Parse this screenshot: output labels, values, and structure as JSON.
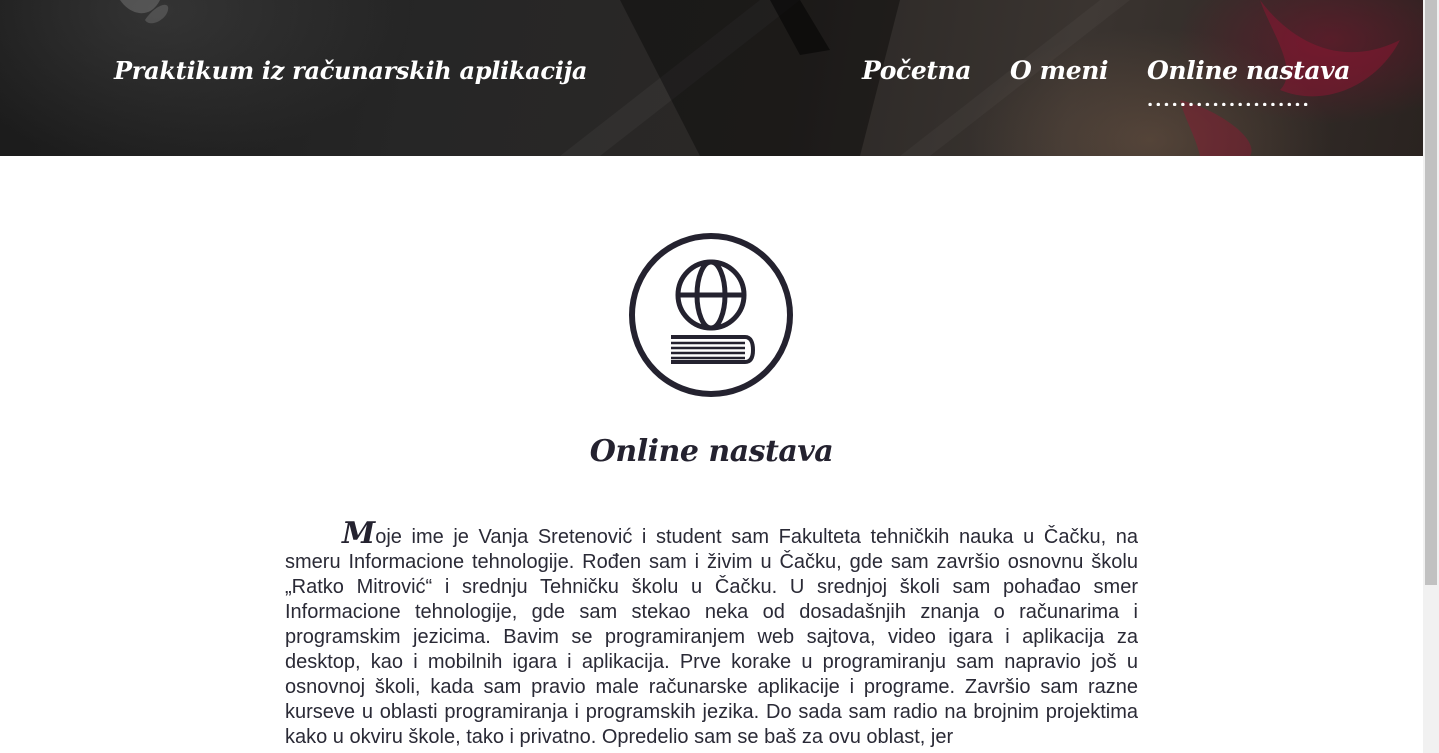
{
  "header": {
    "site_title": "Praktikum iz računarskih aplikacija",
    "nav": [
      {
        "label": "Početna",
        "active": false
      },
      {
        "label": "O meni",
        "active": false
      },
      {
        "label": "Online nastava",
        "active": true
      }
    ]
  },
  "main": {
    "icon": "globe-on-book-icon",
    "title": "Online nastava",
    "bio_first_letter": "M",
    "bio_rest": "oje ime je Vanja Sretenović i student sam Fakulteta tehničkih nauka u Čačku, na smeru Informacione tehnologije. Rođen sam i živim u Čačku, gde sam završio osnovnu školu „Ratko Mitrović“ i srednju Tehničku školu u Čačku. U srednjoj školi sam pohađao smer Informacione tehnologije, gde sam stekao neka od dosadašnjih znanja o računarima i programskim jezicima. Bavim se programiranjem web sajtova, video igara i aplikacija za desktop, kao i mobilnih igara i aplikacija. Prve korake u programiranju sam napravio još u osnovnoj školi, kada sam pravio male računarske aplikacije i programe. Završio sam razne kurseve u oblasti programiranja i programskih jezika. Do sada sam radio na brojnim projektima kako u okviru škole, tako i privatno. Opredelio sam se baš za ovu oblast, jer"
  },
  "colors": {
    "text_dark": "#24222f",
    "header_text": "#ffffff",
    "accent_leaf": "#78142d"
  }
}
